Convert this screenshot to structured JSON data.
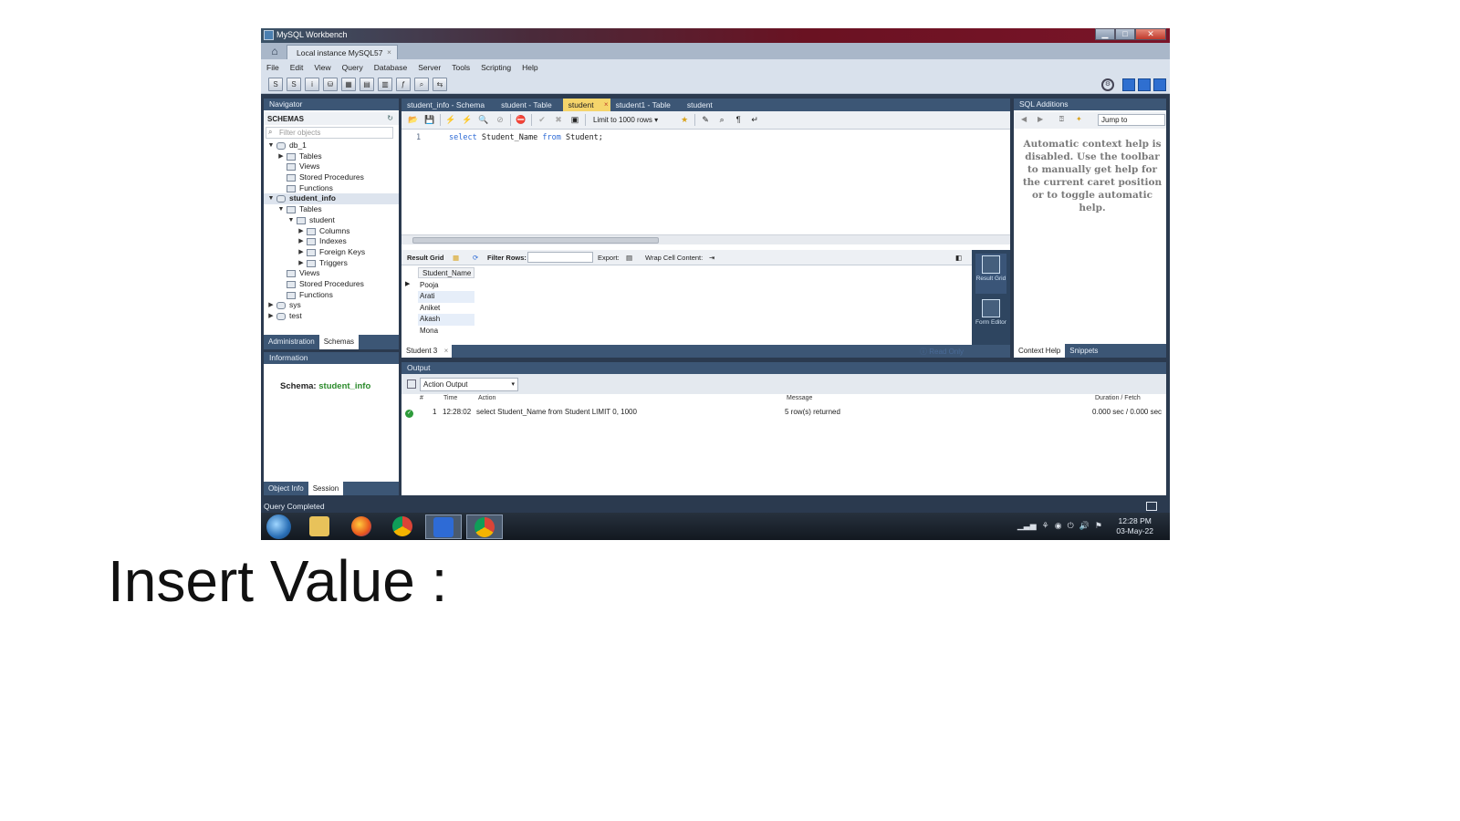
{
  "window": {
    "title": "MySQL Workbench",
    "connection_tab": "Local instance MySQL57",
    "connection_tab_close": "×",
    "controls": {
      "minimize": "▁",
      "maximize": "□",
      "close": "✕"
    }
  },
  "menu": [
    "File",
    "Edit",
    "View",
    "Query",
    "Database",
    "Server",
    "Tools",
    "Scripting",
    "Help"
  ],
  "navigator": {
    "header": "Navigator",
    "schemas_label": "SCHEMAS",
    "filter_placeholder": "Filter objects",
    "tree": [
      {
        "label": "db_1",
        "level": 0,
        "arrow": "▼",
        "icon": "database-icon"
      },
      {
        "label": "Tables",
        "level": 1,
        "arrow": "▶",
        "icon": "table-group-icon"
      },
      {
        "label": "Views",
        "level": 1,
        "arrow": "",
        "icon": "view-group-icon"
      },
      {
        "label": "Stored Procedures",
        "level": 1,
        "arrow": "",
        "icon": "procedure-group-icon"
      },
      {
        "label": "Functions",
        "level": 1,
        "arrow": "",
        "icon": "function-group-icon"
      },
      {
        "label": "student_info",
        "level": 0,
        "arrow": "▼",
        "icon": "database-icon",
        "selected": true
      },
      {
        "label": "Tables",
        "level": 1,
        "arrow": "▼",
        "icon": "table-group-icon"
      },
      {
        "label": "student",
        "level": 2,
        "arrow": "▼",
        "icon": "table-icon"
      },
      {
        "label": "Columns",
        "level": 3,
        "arrow": "▶",
        "icon": "columns-icon"
      },
      {
        "label": "Indexes",
        "level": 3,
        "arrow": "▶",
        "icon": "indexes-icon"
      },
      {
        "label": "Foreign Keys",
        "level": 3,
        "arrow": "▶",
        "icon": "foreign-keys-icon"
      },
      {
        "label": "Triggers",
        "level": 3,
        "arrow": "▶",
        "icon": "triggers-icon"
      },
      {
        "label": "Views",
        "level": 1,
        "arrow": "",
        "icon": "view-group-icon"
      },
      {
        "label": "Stored Procedures",
        "level": 1,
        "arrow": "",
        "icon": "procedure-group-icon"
      },
      {
        "label": "Functions",
        "level": 1,
        "arrow": "",
        "icon": "function-group-icon"
      },
      {
        "label": "sys",
        "level": 0,
        "arrow": "▶",
        "icon": "database-icon"
      },
      {
        "label": "test",
        "level": 0,
        "arrow": "▶",
        "icon": "database-icon"
      }
    ],
    "tabs": [
      "Administration",
      "Schemas"
    ],
    "active_tab": "Schemas"
  },
  "information": {
    "header": "Information",
    "schema_label": "Schema:",
    "schema_value": "student_info",
    "tabs": [
      "Object Info",
      "Session"
    ]
  },
  "editor_tabs": [
    {
      "label": "student_info - Schema",
      "active": false
    },
    {
      "label": "student - Table",
      "active": false
    },
    {
      "label": "student",
      "active": true
    },
    {
      "label": "student1 - Table",
      "active": false
    },
    {
      "label": "student",
      "active": false
    }
  ],
  "editor_tab_close": "×",
  "sql_toolbar": {
    "limit_label": "Limit to 1000 rows"
  },
  "editor": {
    "line_number": "1",
    "kw1": "select",
    "mid": " Student_Name ",
    "kw2": "from",
    "rest": " Student;"
  },
  "result_toolbar": {
    "result_grid": "Result Grid",
    "filter_rows": "Filter Rows:",
    "export": "Export:",
    "wrap": "Wrap Cell Content:"
  },
  "grid": {
    "column": "Student_Name",
    "rows": [
      "Pooja",
      "Arati",
      "Aniket",
      "Akash",
      "Mona"
    ]
  },
  "result_side": {
    "result_grid": "Result Grid",
    "form_editor": "Form Editor"
  },
  "result_tab": "Student 3",
  "result_tab_close": "×",
  "read_only": "Read Only",
  "sql_additions": {
    "header": "SQL Additions",
    "jump_to": "Jump to",
    "help_text": "Automatic context help is disabled. Use the toolbar to manually get help for the current caret position or to toggle automatic help.",
    "tabs": [
      "Context Help",
      "Snippets"
    ]
  },
  "output": {
    "header": "Output",
    "selector": "Action Output",
    "columns": {
      "num": "#",
      "time": "Time",
      "action": "Action",
      "message": "Message",
      "duration": "Duration / Fetch"
    },
    "rows": [
      {
        "num": "1",
        "time": "12:28:02",
        "action": "select Student_Name from Student LIMIT 0, 1000",
        "message": "5 row(s) returned",
        "duration": "0.000 sec / 0.000 sec"
      }
    ]
  },
  "status": {
    "text": "Query Completed"
  },
  "taskbar": {
    "time": "12:28 PM",
    "date": "03-May-22",
    "apps": [
      "explorer-icon",
      "firefox-icon",
      "chrome-icon",
      "workbench-icon",
      "chrome-alt-icon"
    ]
  },
  "caption": "Insert Value :"
}
